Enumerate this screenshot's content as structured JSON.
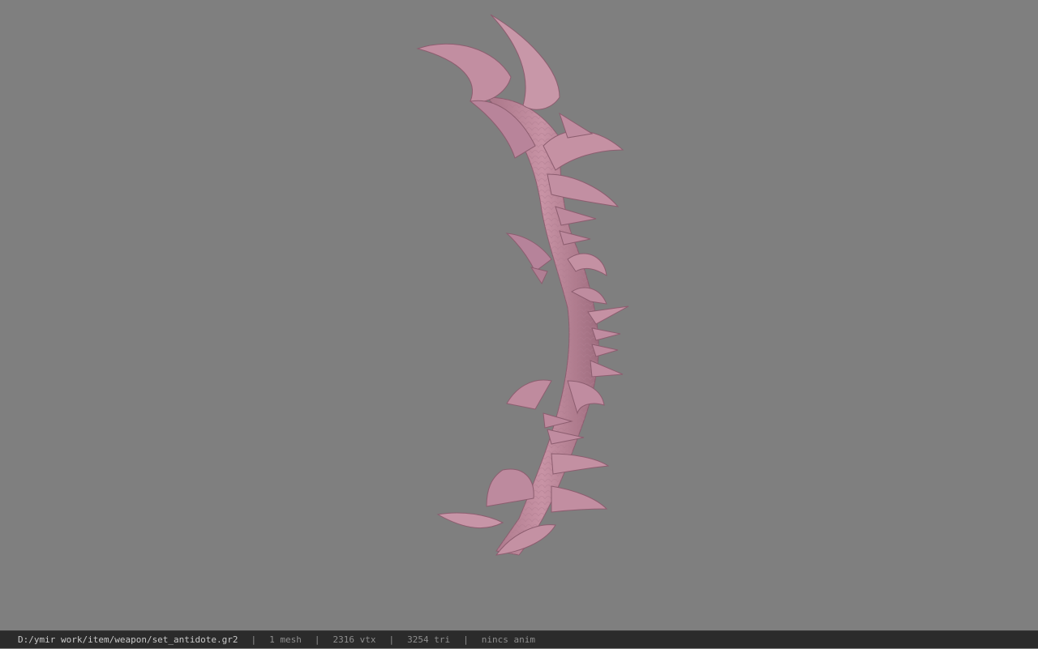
{
  "viewport": {
    "background": "#7f7f7f",
    "model_color": "#c08e9f"
  },
  "statusbar": {
    "file_path": "D:/ymir work/item/weapon/set_antidote.gr2",
    "mesh_count": "1 mesh",
    "vertex_count": "2316 vtx",
    "triangle_count": "3254 tri",
    "anim_status": "nincs anim",
    "separator": "|"
  }
}
